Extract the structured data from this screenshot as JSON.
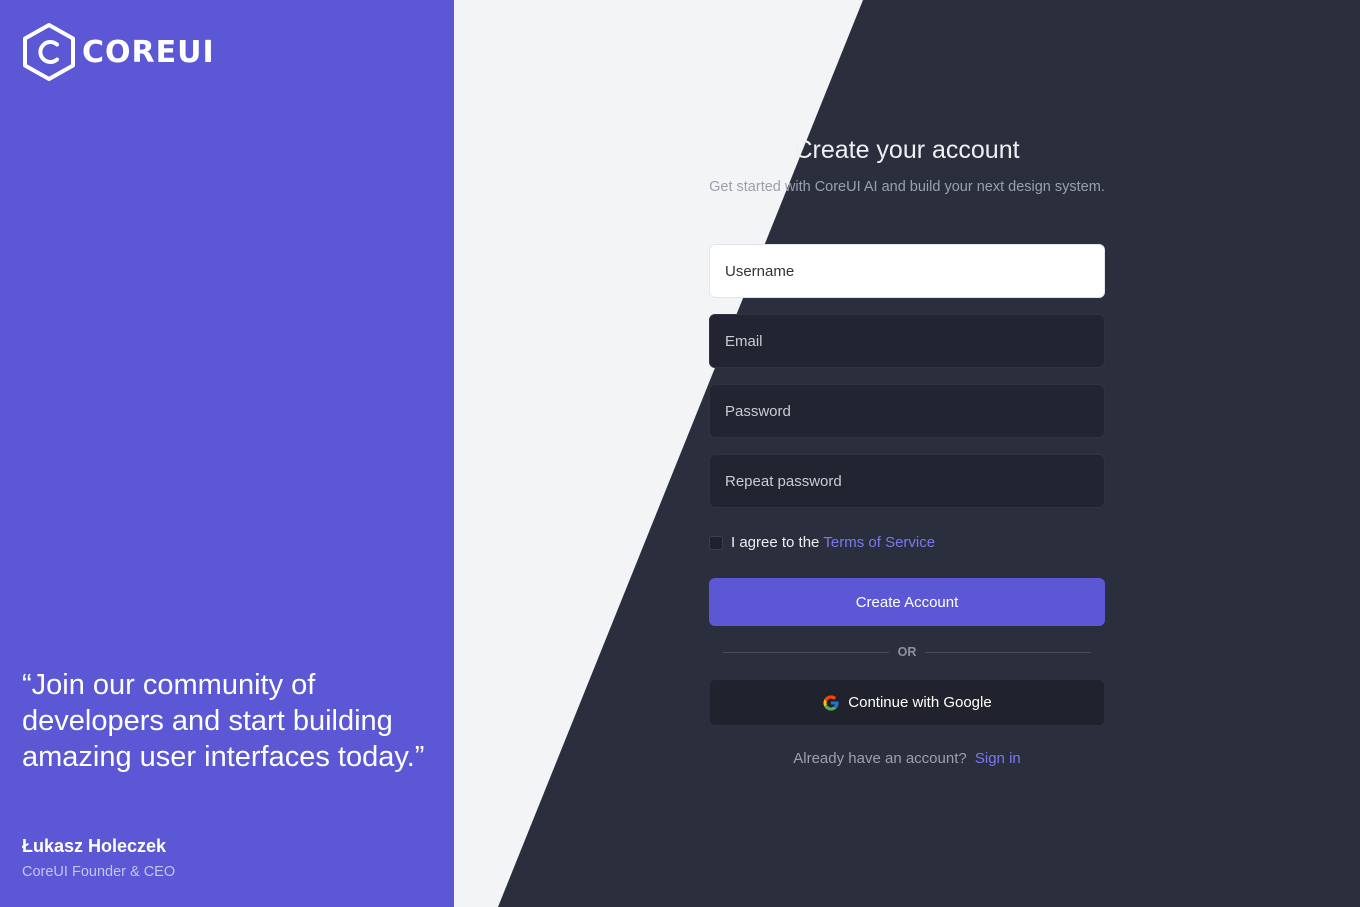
{
  "brand": {
    "logo_text": "COREUI",
    "accent_color": "#5b57d5"
  },
  "left_panel": {
    "quote": "“Join our community of developers and start building amazing user interfaces today.”",
    "author_name": "Łukasz Holeczek",
    "author_role": "CoreUI Founder & CEO"
  },
  "form": {
    "title": "Create your account",
    "subtitle": "Get started with CoreUI AI and build your next design system.",
    "fields": {
      "username": {
        "placeholder": "Username",
        "value": ""
      },
      "email": {
        "placeholder": "Email",
        "value": ""
      },
      "password": {
        "placeholder": "Password",
        "value": ""
      },
      "repeat_password": {
        "placeholder": "Repeat password",
        "value": ""
      }
    },
    "agree_text": "I agree to the",
    "terms_link": "Terms of Service",
    "agree_checked": false,
    "submit_label": "Create Account",
    "divider_label": "OR",
    "google_label": "Continue with Google",
    "google_icon": "google-icon",
    "signin_prompt": "Already have an account?",
    "signin_link": "Sign in"
  }
}
